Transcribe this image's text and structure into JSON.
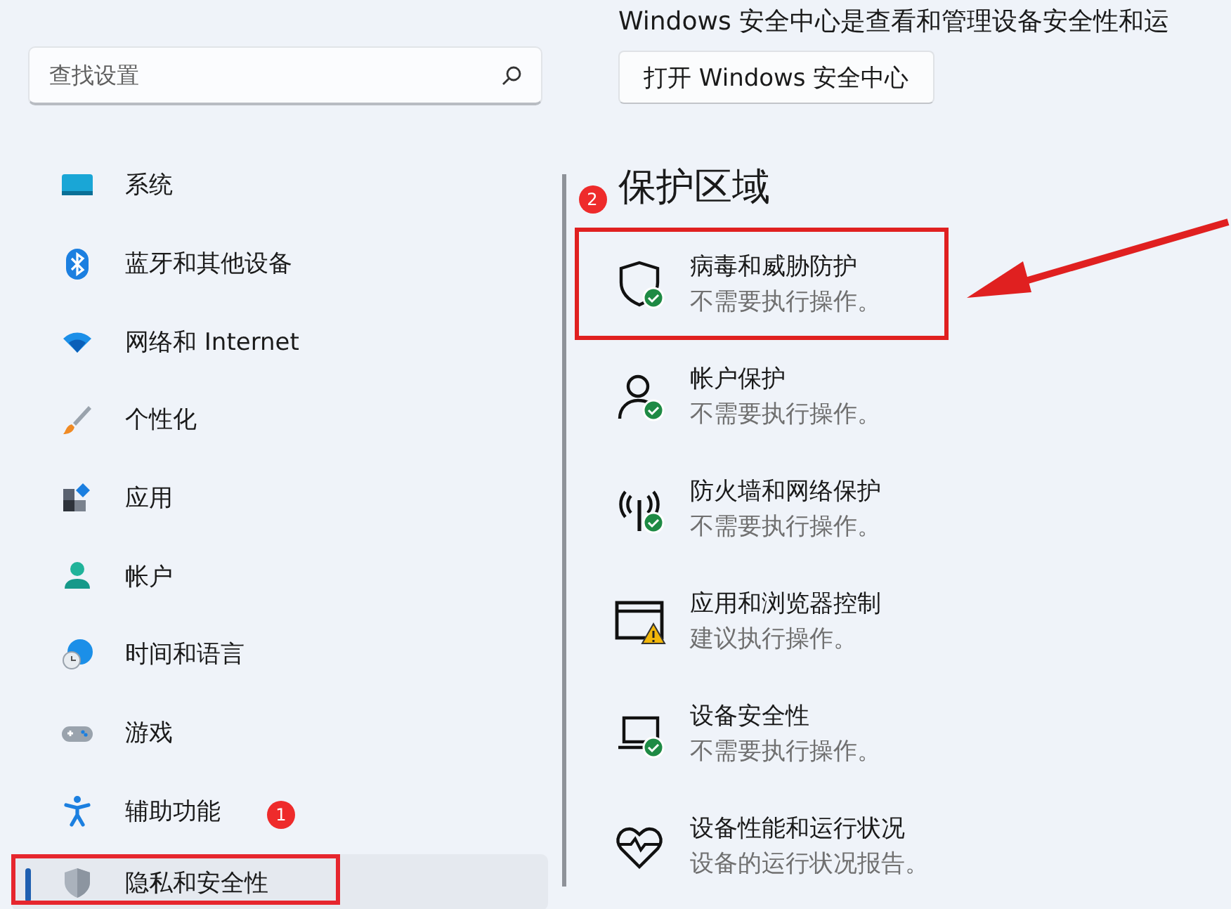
{
  "search": {
    "placeholder": "查找设置"
  },
  "nav": [
    {
      "label": "系统",
      "kind": "system",
      "selected": false,
      "highlighted": false
    },
    {
      "label": "蓝牙和其他设备",
      "kind": "bluetooth",
      "selected": false,
      "highlighted": false
    },
    {
      "label": "网络和 Internet",
      "kind": "wifi",
      "selected": false,
      "highlighted": false
    },
    {
      "label": "个性化",
      "kind": "brush",
      "selected": false,
      "highlighted": false
    },
    {
      "label": "应用",
      "kind": "apps",
      "selected": false,
      "highlighted": false
    },
    {
      "label": "帐户",
      "kind": "person",
      "selected": false,
      "highlighted": false
    },
    {
      "label": "时间和语言",
      "kind": "globe",
      "selected": false,
      "highlighted": false
    },
    {
      "label": "游戏",
      "kind": "gamepad",
      "selected": false,
      "highlighted": false
    },
    {
      "label": "辅助功能",
      "kind": "accessibility",
      "selected": false,
      "highlighted": false,
      "badge": "1"
    },
    {
      "label": "隐私和安全性",
      "kind": "shield",
      "selected": true,
      "highlighted": true
    }
  ],
  "description": "Windows 安全中心是查看和管理设备安全性和运",
  "open_button": "打开 Windows 安全中心",
  "section": {
    "title": "保护区域",
    "badge": "2"
  },
  "areas": [
    {
      "title": "病毒和威胁防护",
      "status_text": "不需要执行操作。",
      "kind": "shield",
      "ok": true,
      "warning": false,
      "highlighted": true
    },
    {
      "title": "帐户保护",
      "status_text": "不需要执行操作。",
      "kind": "person",
      "ok": true,
      "warning": false,
      "highlighted": false
    },
    {
      "title": "防火墙和网络保护",
      "status_text": "不需要执行操作。",
      "kind": "antenna",
      "ok": true,
      "warning": false,
      "highlighted": false
    },
    {
      "title": "应用和浏览器控制",
      "status_text": "建议执行操作。",
      "kind": "window",
      "ok": false,
      "warning": true,
      "highlighted": false
    },
    {
      "title": "设备安全性",
      "status_text": "不需要执行操作。",
      "kind": "laptop",
      "ok": true,
      "warning": false,
      "highlighted": false
    },
    {
      "title": "设备性能和运行状况",
      "status_text": "设备的运行状况报告。",
      "kind": "heart",
      "ok": false,
      "warning": false,
      "highlighted": false
    }
  ],
  "pointer_arrow": true
}
